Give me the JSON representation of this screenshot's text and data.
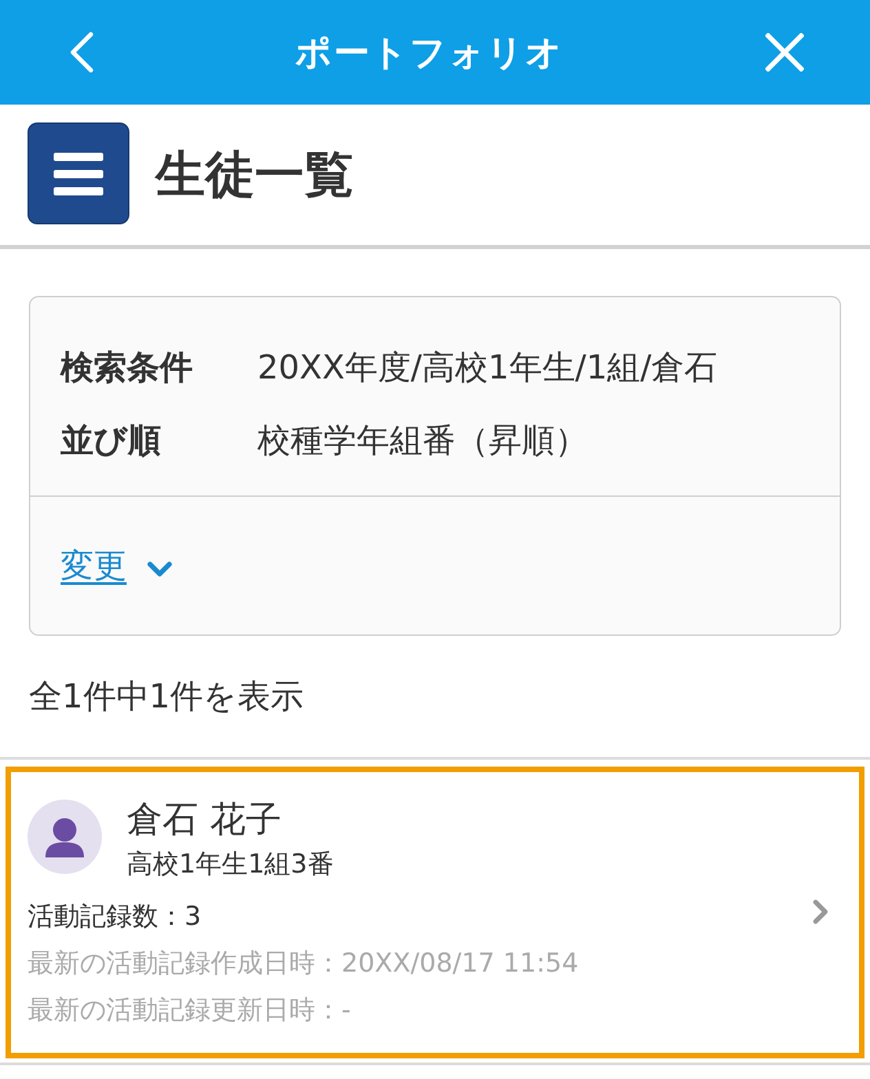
{
  "header": {
    "title": "ポートフォリオ"
  },
  "page": {
    "title": "生徒一覧"
  },
  "search": {
    "conditions": [
      {
        "label": "検索条件",
        "value": "20XX年度/高校1年生/1組/倉石"
      },
      {
        "label": "並び順",
        "value": "校種学年組番（昇順）"
      }
    ],
    "change_link": "変更",
    "expanded": false
  },
  "result_count": "全1件中1件を表示",
  "students": [
    {
      "name": "倉石 花子",
      "class": "高校1年生1組3番",
      "activity_count": "活動記録数：3",
      "created": "最新の活動記録作成日時：20XX/08/17 11:54",
      "updated": "最新の活動記録更新日時：-",
      "selected": true
    }
  ]
}
